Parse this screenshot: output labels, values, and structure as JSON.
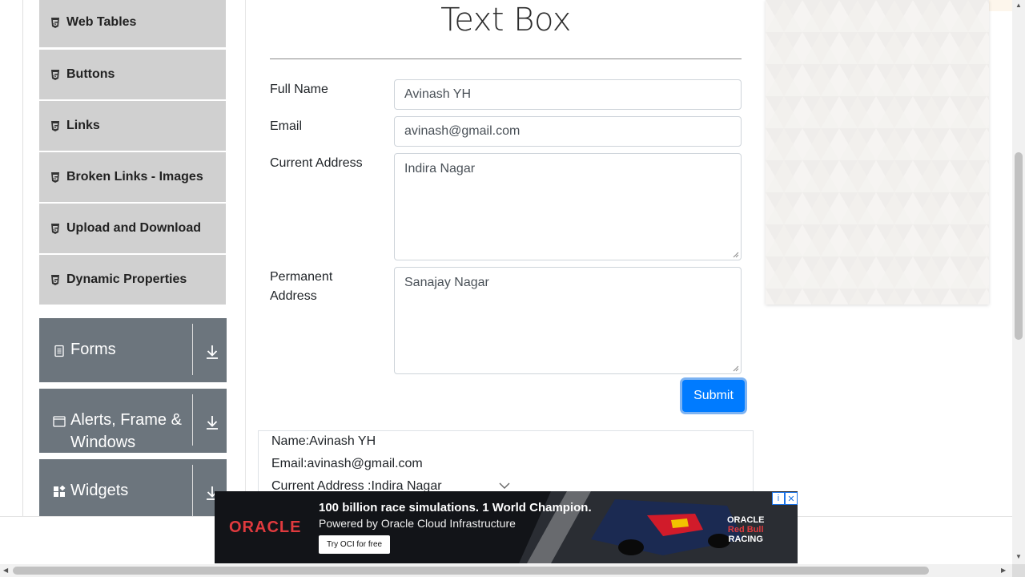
{
  "sidebar": {
    "items": [
      {
        "label": "Web Tables"
      },
      {
        "label": "Buttons"
      },
      {
        "label": "Links"
      },
      {
        "label": "Broken Links - Images"
      },
      {
        "label": "Upload and Download"
      },
      {
        "label": "Dynamic Properties"
      }
    ],
    "groups": [
      {
        "label": "Forms"
      },
      {
        "label": "Alerts, Frame &",
        "label2": "Windows"
      },
      {
        "label": "Widgets"
      }
    ]
  },
  "main": {
    "title": "Text Box",
    "fields": {
      "full_name_label": "Full Name",
      "full_name_value": "Avinash YH",
      "email_label": "Email",
      "email_value": "avinash@gmail.com",
      "current_address_label": "Current Address",
      "current_address_value": "Indira Nagar",
      "permanent_address_label_1": "Permanent",
      "permanent_address_label_2": "Address",
      "permanent_address_value": "Sanajay Nagar"
    },
    "submit_label": "Submit",
    "output": {
      "name": "Name:Avinash YH",
      "email": "Email:avinash@gmail.com",
      "current_address": "Current Address :Indira Nagar"
    }
  },
  "ad": {
    "brand": "ORACLE",
    "headline": "100 billion race simulations. 1 World Champion.",
    "subline": "Powered by Oracle Cloud Infrastructure",
    "cta": "Try OCI for free",
    "brand2_top": "ORACLE",
    "brand2_mid": "Red Bull",
    "brand2_bottom": "RACING"
  },
  "colors": {
    "primary": "#007bff",
    "sidebar_item_bg": "#d0d0d0",
    "group_bg": "#6c757d"
  }
}
